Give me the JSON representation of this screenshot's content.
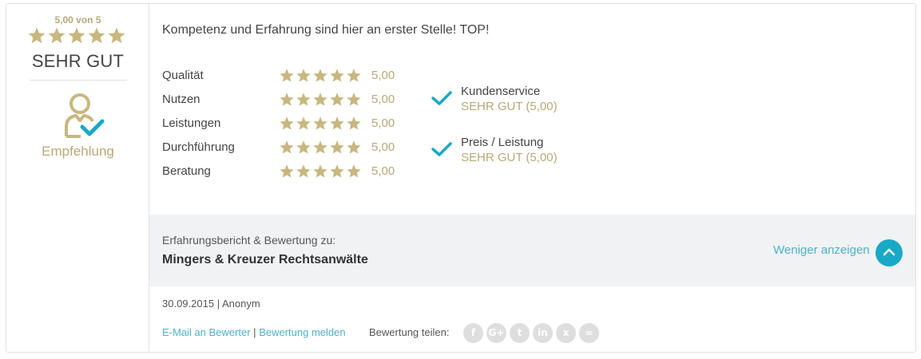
{
  "overall": {
    "score_text": "5,00 von 5",
    "rating_label": "SEHR GUT",
    "stars": 5,
    "recommendation_label": "Empfehlung"
  },
  "review": {
    "headline": "Kompetenz und Erfahrung sind hier an erster Stelle! TOP!",
    "criteria": [
      {
        "name": "Qualität",
        "stars": 5,
        "value": "5,00"
      },
      {
        "name": "Nutzen",
        "stars": 5,
        "value": "5,00"
      },
      {
        "name": "Leistungen",
        "stars": 5,
        "value": "5,00"
      },
      {
        "name": "Durchführung",
        "stars": 5,
        "value": "5,00"
      },
      {
        "name": "Beratung",
        "stars": 5,
        "value": "5,00"
      }
    ],
    "features": [
      {
        "name": "Kundenservice",
        "value": "SEHR GUT (5,00)"
      },
      {
        "name": "Preis / Leistung",
        "value": "SEHR GUT (5,00)"
      }
    ]
  },
  "subject": {
    "label": "Erfahrungsbericht & Bewertung zu:",
    "company": "Mingers & Kreuzer Rechtsanwälte",
    "toggle_label": "Weniger anzeigen"
  },
  "meta": {
    "date": "30.09.2015",
    "separator": "|",
    "author": "Anonym"
  },
  "actions": {
    "email_label": "E-Mail an Bewerter",
    "separator": "|",
    "report_label": "Bewertung melden",
    "share_label": "Bewertung teilen:"
  },
  "share_icons": [
    {
      "name": "facebook-icon",
      "glyph": "f"
    },
    {
      "name": "google-plus-icon",
      "glyph": "G+"
    },
    {
      "name": "twitter-icon",
      "glyph": "t"
    },
    {
      "name": "linkedin-icon",
      "glyph": "in"
    },
    {
      "name": "xing-icon",
      "glyph": "x"
    },
    {
      "name": "link-icon",
      "glyph": "∞"
    }
  ],
  "colors": {
    "gold": "#c9b77f",
    "gold_text": "#b8a877",
    "accent": "#1aa8c7",
    "link": "#4bb2c7",
    "band": "#f1f2f3",
    "share_icon": "#dedede"
  }
}
